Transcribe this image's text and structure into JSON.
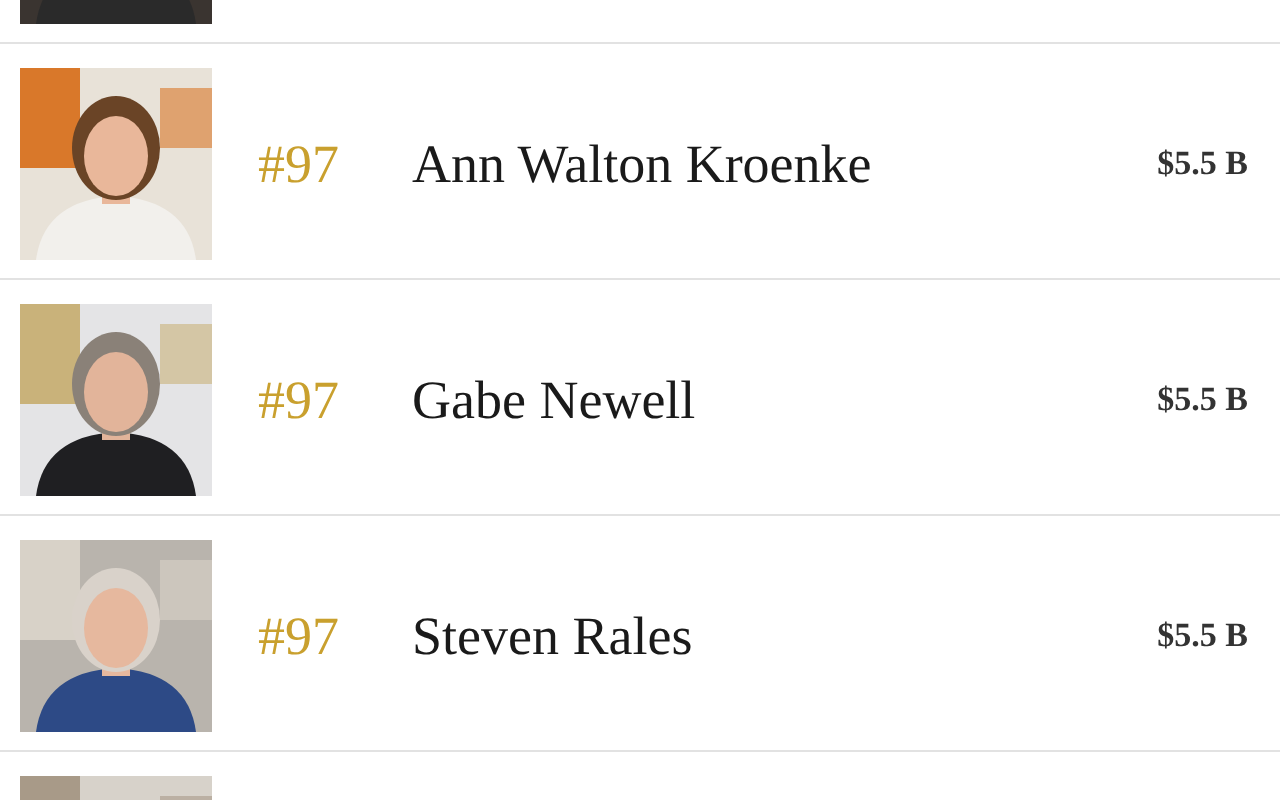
{
  "rows": [
    {
      "photo": {
        "kind": "picture"
      }
    },
    {
      "photo": {
        "kind": "picture"
      },
      "rank": "#97",
      "name": "Ann Walton Kroenke",
      "net_worth": "$5.5 B"
    },
    {
      "photo": {
        "kind": "picture"
      },
      "rank": "#97",
      "name": "Gabe Newell",
      "net_worth": "$5.5 B"
    },
    {
      "photo": {
        "kind": "picture"
      },
      "rank": "#97",
      "name": "Steven Rales",
      "net_worth": "$5.5 B"
    },
    {
      "photo": {
        "kind": "picture"
      }
    }
  ]
}
